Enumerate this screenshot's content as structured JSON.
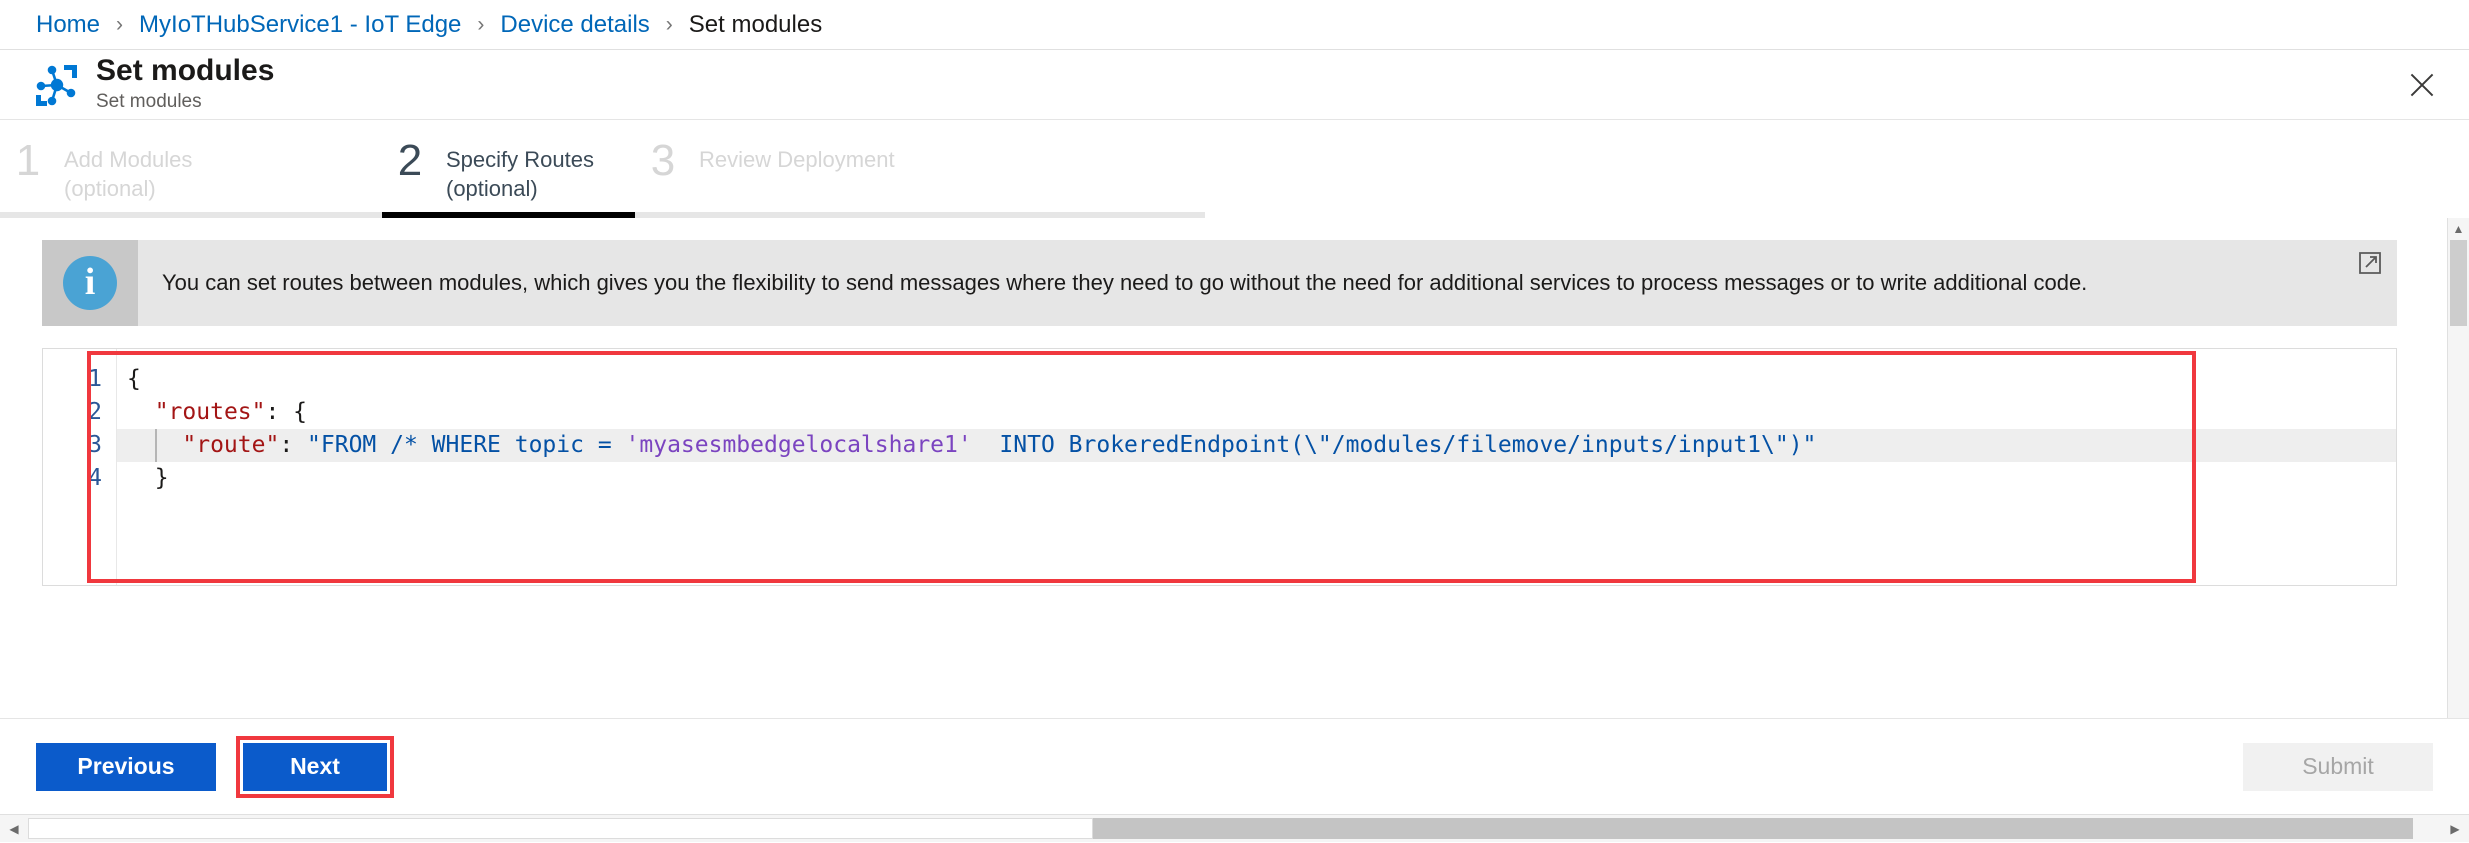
{
  "breadcrumb": {
    "separator": "›",
    "items": [
      {
        "label": "Home",
        "current": false
      },
      {
        "label": "MyIoTHubService1 - IoT Edge",
        "current": false
      },
      {
        "label": "Device details",
        "current": false
      },
      {
        "label": "Set modules",
        "current": true
      }
    ]
  },
  "header": {
    "icon": "iot-edge-modules-icon",
    "title": "Set modules",
    "subtitle": "Set modules",
    "close_icon": "close-icon"
  },
  "steps": [
    {
      "number": "1",
      "label_line1": "Add Modules",
      "label_line2": "(optional)",
      "state": "inactive"
    },
    {
      "number": "2",
      "label_line1": "Specify Routes",
      "label_line2": "(optional)",
      "state": "active"
    },
    {
      "number": "3",
      "label_line1": "Review Deployment",
      "label_line2": "",
      "state": "inactive"
    }
  ],
  "info_banner": {
    "icon": "info-icon",
    "text": "You can set routes between modules, which gives you the flexibility to send messages where they need to go without the need for additional services to process messages or to write additional code.",
    "link_icon": "external-link-icon"
  },
  "editor": {
    "line_numbers": [
      "1",
      "2",
      "3",
      "4"
    ],
    "lines": [
      {
        "indent": 0,
        "tokens": [
          {
            "t": "punct",
            "v": "{"
          }
        ]
      },
      {
        "indent": 1,
        "tokens": [
          {
            "t": "key",
            "v": "\"routes\""
          },
          {
            "t": "punct",
            "v": ": {"
          }
        ]
      },
      {
        "indent": 2,
        "tokens": [
          {
            "t": "key",
            "v": "\"route\""
          },
          {
            "t": "punct",
            "v": ": "
          },
          {
            "t": "str",
            "v": "\"FROM /* WHERE topic = "
          },
          {
            "t": "topic",
            "v": "'myasesmbedgelocalshare1'"
          },
          {
            "t": "str",
            "v": "  INTO BrokeredEndpoint(\\\"/modules/filemove/inputs/input1\\\")\""
          }
        ]
      },
      {
        "indent": 1,
        "tokens": [
          {
            "t": "punct",
            "v": "}"
          }
        ]
      }
    ],
    "highlighted_line": 3,
    "annotation": "red-highlight-box"
  },
  "footer": {
    "previous_label": "Previous",
    "next_label": "Next",
    "next_annotation": "red-highlight-box",
    "submit_label": "Submit",
    "submit_disabled": true
  },
  "scrollbars": {
    "vertical_up": "▲",
    "vertical_down": "▼",
    "horizontal_left": "◀",
    "horizontal_right": "▶"
  },
  "colors": {
    "link_blue": "#0067b8",
    "button_blue": "#0b5bcb",
    "annotation_red": "#f0383e",
    "info_icon_blue": "#4aa3d4",
    "active_step": "#3b4a57"
  }
}
